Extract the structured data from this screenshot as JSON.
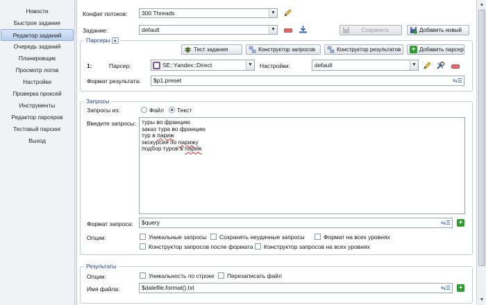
{
  "sidebar": {
    "items": [
      {
        "label": "Новости"
      },
      {
        "label": "Быстрое задание"
      },
      {
        "label": "Редактор заданий"
      },
      {
        "label": "Очередь заданий"
      },
      {
        "label": "Планировщик"
      },
      {
        "label": "Просмотр логов"
      },
      {
        "label": "Настройки"
      },
      {
        "label": "Проверка проксей"
      },
      {
        "label": "Инструменты"
      },
      {
        "label": "Редактор парсеров"
      },
      {
        "label": "Тестовый парсинг"
      },
      {
        "label": "Выход"
      }
    ],
    "active_index": 2
  },
  "header": {
    "threads_label": "Конфиг потоков:",
    "threads_value": "300 Threads",
    "task_label": "Задание:",
    "task_value": "default",
    "save_label": "Сохранить",
    "add_new_label": "Добавить новый"
  },
  "parsers": {
    "legend": "Парсеры",
    "test_task_label": "Тест задания",
    "query_builder_label": "Конструктор запросов",
    "result_builder_label": "Конструктор результатов",
    "add_parser_label": "Добавить парсер",
    "row_index": "1:",
    "parser_label": "Парсер:",
    "parser_value": "SE::Yandex::Direct",
    "settings_label": "Настройки:",
    "settings_value": "default",
    "result_format_label": "Формат результата:",
    "result_format_value": "$p1.preset"
  },
  "queries": {
    "legend": "Запросы",
    "source_label": "Запросы из:",
    "option_file": "Файл",
    "option_text": "Текст",
    "selected": "Текст",
    "enter_label": "Введите запросы:",
    "lines": [
      "туры во францию",
      "заказ тура во францию",
      "тур в париж",
      "экскурсия по парижу",
      "подбор туров в париж"
    ],
    "format_label": "Формат запроса:",
    "format_value": "$query",
    "options_label": "Опции:",
    "opt_unique": "Уникальные запросы",
    "opt_save_failed": "Сохранять неудачные запросы",
    "opt_format_all": "Формат на всех уровнях",
    "opt_builder_after": "Конструктор запросов после формата",
    "opt_builder_all": "Конструктор запросов на всех уровнях"
  },
  "results": {
    "legend": "Результаты",
    "options_label": "Опции:",
    "opt_unique_line": "Уникальность по строке",
    "opt_overwrite": "Перезаписать файл",
    "filename_label": "Имя файла:",
    "filename_value": "$datefile.format().txt"
  }
}
